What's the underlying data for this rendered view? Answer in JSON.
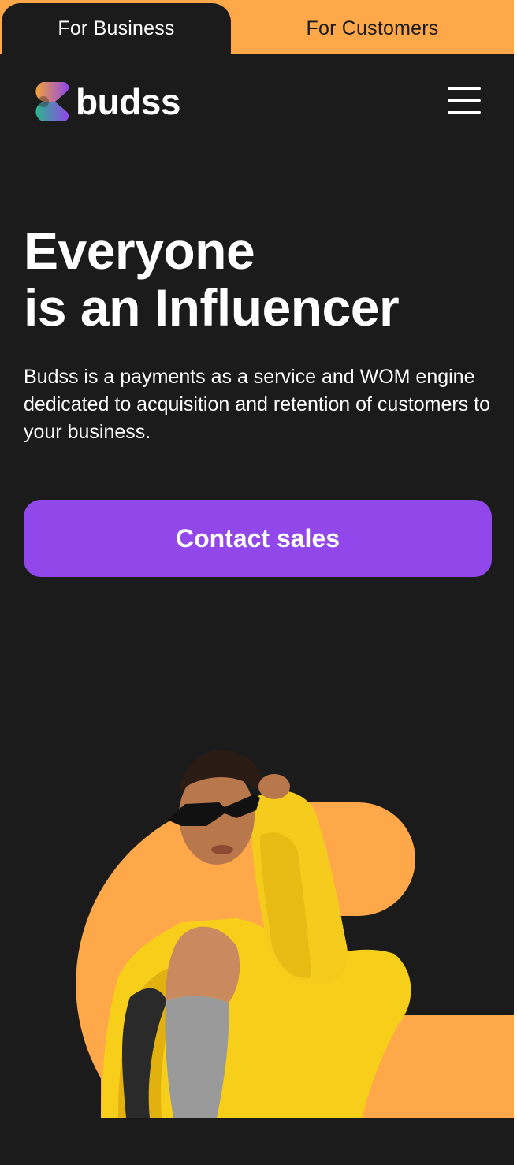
{
  "switcher": {
    "business_label": "For Business",
    "customers_label": "For Customers"
  },
  "header": {
    "logo_text": "budss",
    "menu_icon": "hamburger-menu-icon"
  },
  "hero": {
    "title_line1": "Everyone",
    "title_line2": "is an Influencer",
    "description": "Budss is a payments as a service and WOM engine dedicated to acquisition and retention of customers to your business.",
    "cta_label": "Contact sales"
  },
  "colors": {
    "background": "#1b1b1b",
    "accent_orange": "#ffa84a",
    "cta_purple": "#9147e9",
    "text": "#ffffff"
  }
}
